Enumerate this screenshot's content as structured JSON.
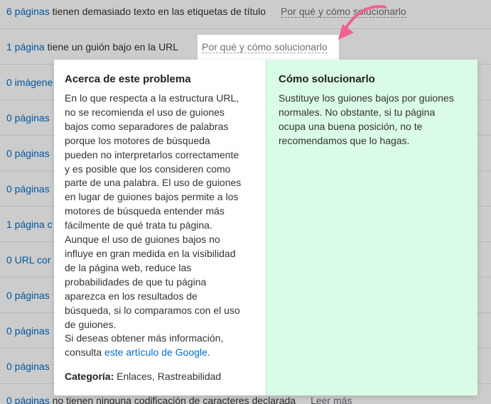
{
  "rows": [
    {
      "count": "6 páginas",
      "rest": " tienen demasiado texto en las etiquetas de título",
      "solution": "Por qué y cómo solucionarlo"
    },
    {
      "count": "1 página",
      "rest": " tiene un guión bajo en la URL",
      "solution": "Por qué y cómo solucionarlo"
    },
    {
      "count": "0 imágene",
      "rest": "",
      "solution": ""
    },
    {
      "count": "0 páginas",
      "rest": "",
      "solution": ""
    },
    {
      "count": "0 páginas",
      "rest": "",
      "solution": ""
    },
    {
      "count": "0 páginas",
      "rest": "",
      "solution": ""
    },
    {
      "count": "1 página c",
      "rest": "",
      "solution": ""
    },
    {
      "count": "0 URL cor",
      "rest": "",
      "solution": ""
    },
    {
      "count": "0 páginas",
      "rest": "",
      "solution": ""
    },
    {
      "count": "0 páginas",
      "rest": "",
      "solution": ""
    },
    {
      "count": "0 páginas",
      "rest": "",
      "solution": ""
    },
    {
      "count": "0 páginas",
      "rest": " no tienen ninguna codificación de caracteres declarada",
      "more": "Leer más"
    }
  ],
  "active_link": "Por qué y cómo solucionarlo",
  "popup": {
    "about_title": "Acerca de este problema",
    "about_lines": [
      "En lo que respecta a la estructura URL,",
      "no se recomienda el uso de guiones",
      "bajos como separadores de palabras",
      "porque los motores de búsqueda",
      "pueden no interpretarlos correctamente",
      "y es posible que los consideren como",
      "parte de una palabra. El uso de guiones",
      "en lugar de guiones bajos permite a los",
      "motores de búsqueda entender más",
      "fácilmente de qué trata tu página.",
      "Aunque el uso de guiones bajos no",
      "influye en gran medida en la visibilidad",
      "de la página web, reduce las",
      "probabilidades de que tu página",
      "aparezca en los resultados de",
      "búsqueda, si lo comparamos con el uso",
      "de guiones.",
      "Si deseas obtener más información,"
    ],
    "about_last_prefix": "consulta ",
    "about_link": "este artículo de Google",
    "about_last_suffix": ".",
    "category_label": "Categoría:",
    "category_value": " Enlaces, Rastreabilidad",
    "fix_title": "Cómo solucionarlo",
    "fix_lines": [
      "Sustituye los guiones bajos por guiones",
      "normales. No obstante, si tu página",
      "ocupa una buena posición, no te",
      "recomendamos que lo hagas."
    ]
  },
  "colors": {
    "link": "#006dca",
    "fix_bg": "#dafbe5",
    "arrow": "#f06292"
  },
  "icons": {
    "arrow": "pink-curved-arrow-icon"
  }
}
